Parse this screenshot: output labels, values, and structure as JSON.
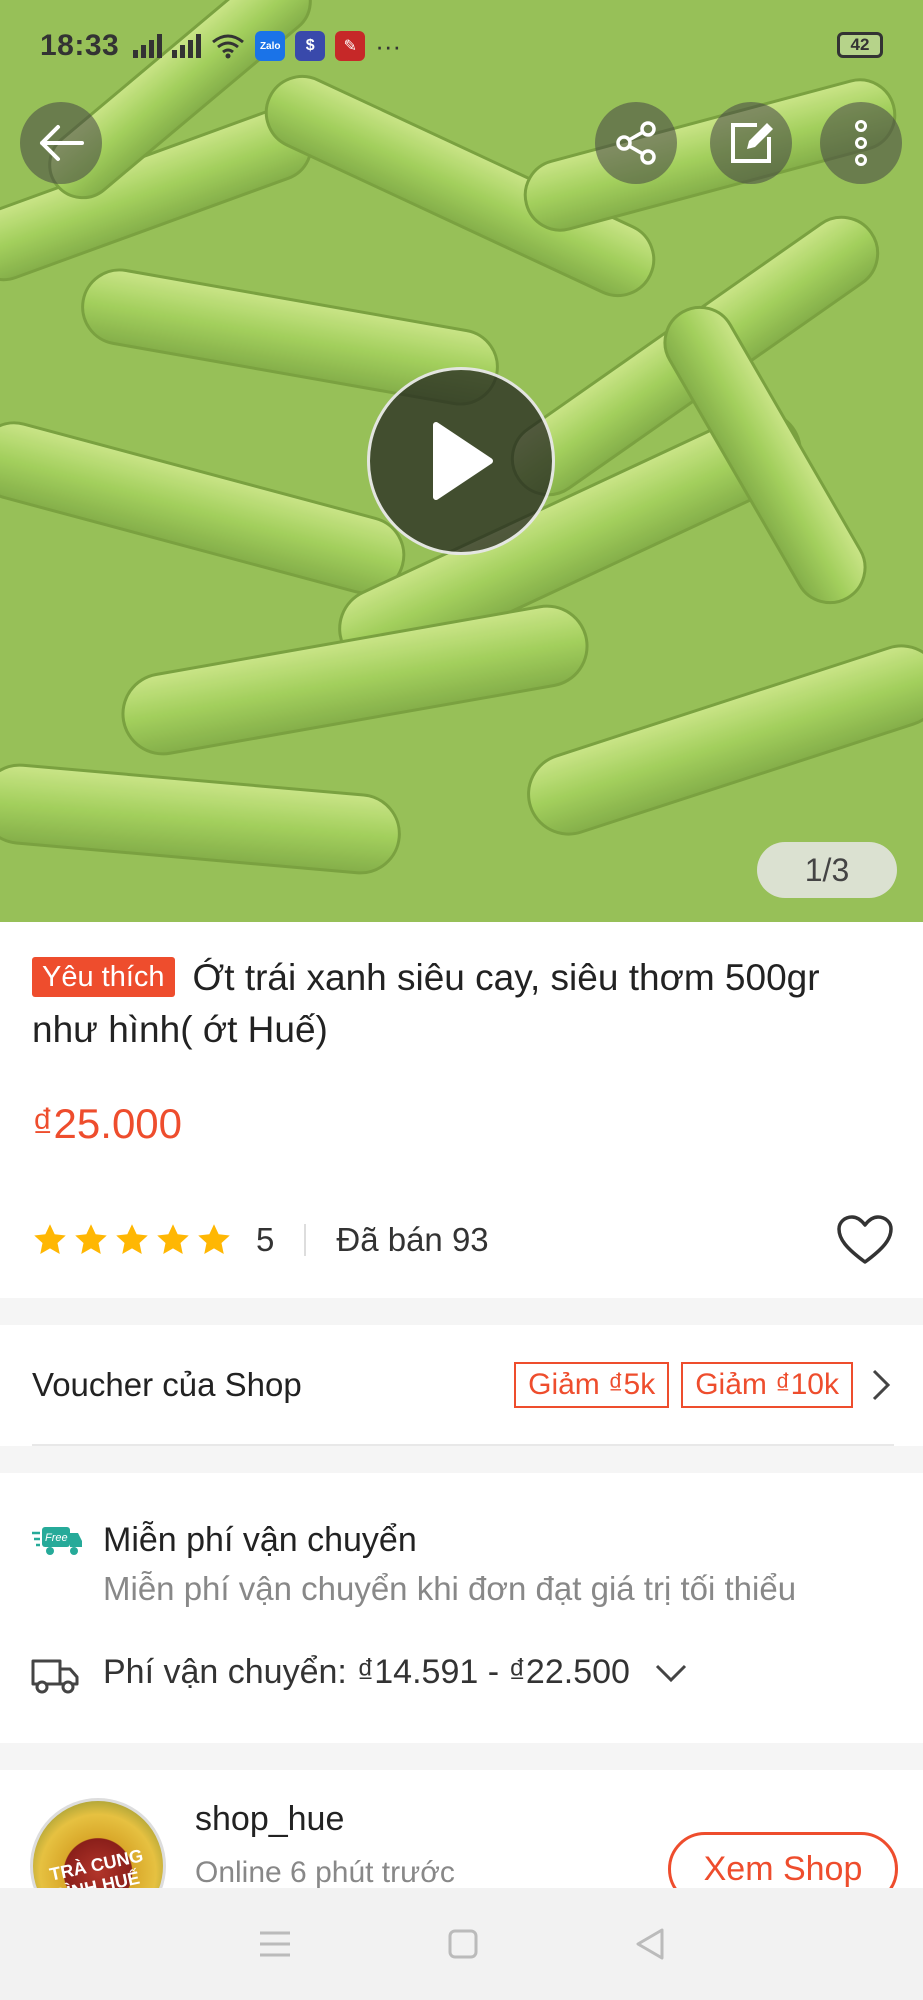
{
  "status_bar": {
    "time": "18:33",
    "battery": "42",
    "more": "···",
    "apps": [
      "Zalo",
      "$",
      "✎"
    ]
  },
  "gallery": {
    "counter": "1/3"
  },
  "product": {
    "badge": "Yêu thích",
    "title": "Ớt trái xanh siêu cay, siêu thơm 500gr như hình( ớt Huế)",
    "price": "₫25.000",
    "rating": "5",
    "star_count": 5,
    "sold": "Đã bán 93"
  },
  "voucher": {
    "label": "Voucher của Shop",
    "tags": [
      "Giảm ₫5k",
      "Giảm ₫10k"
    ]
  },
  "shipping": {
    "free_title": "Miễn phí vận chuyển",
    "free_badge": "Free",
    "free_desc": "Miễn phí vận chuyển khi đơn đạt giá trị tối thiểu",
    "fee_label": "Phí vận chuyển:",
    "fee_value": "₫14.591 - ₫22.500"
  },
  "shop": {
    "name": "shop_hue",
    "status": "Online 6 phút trước",
    "view_button": "Xem Shop",
    "avatar_text": "TRÀ CUNG ĐÌNH HUẾ"
  },
  "colors": {
    "accent": "#ee4d2d",
    "star": "#ffb703",
    "free_icon": "#26aa99"
  }
}
